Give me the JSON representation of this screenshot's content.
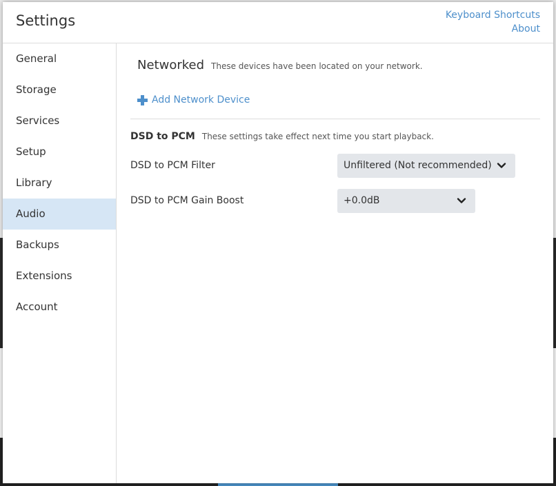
{
  "header": {
    "title": "Settings",
    "links": [
      "Keyboard Shortcuts",
      "About"
    ]
  },
  "sidebar": {
    "items": [
      {
        "label": "General"
      },
      {
        "label": "Storage"
      },
      {
        "label": "Services"
      },
      {
        "label": "Setup"
      },
      {
        "label": "Library"
      },
      {
        "label": "Audio",
        "active": true
      },
      {
        "label": "Backups"
      },
      {
        "label": "Extensions"
      },
      {
        "label": "Account"
      }
    ]
  },
  "main": {
    "networked": {
      "title": "Networked",
      "subtitle": "These devices have been located on your network.",
      "add_label": "Add Network Device"
    },
    "dsd": {
      "title": "DSD to PCM",
      "subtitle": "These settings take effect next time you start playback.",
      "filter_label": "DSD to PCM Filter",
      "filter_value": "Unfiltered (Not recommended)",
      "gain_label": "DSD to PCM Gain Boost",
      "gain_value": "+0.0dB"
    }
  },
  "colors": {
    "accent": "#4d8fcb",
    "active_bg": "#d6e6f5",
    "select_bg": "#e3e6ea"
  },
  "icons": [
    "plus-icon",
    "chevron-down-icon"
  ]
}
